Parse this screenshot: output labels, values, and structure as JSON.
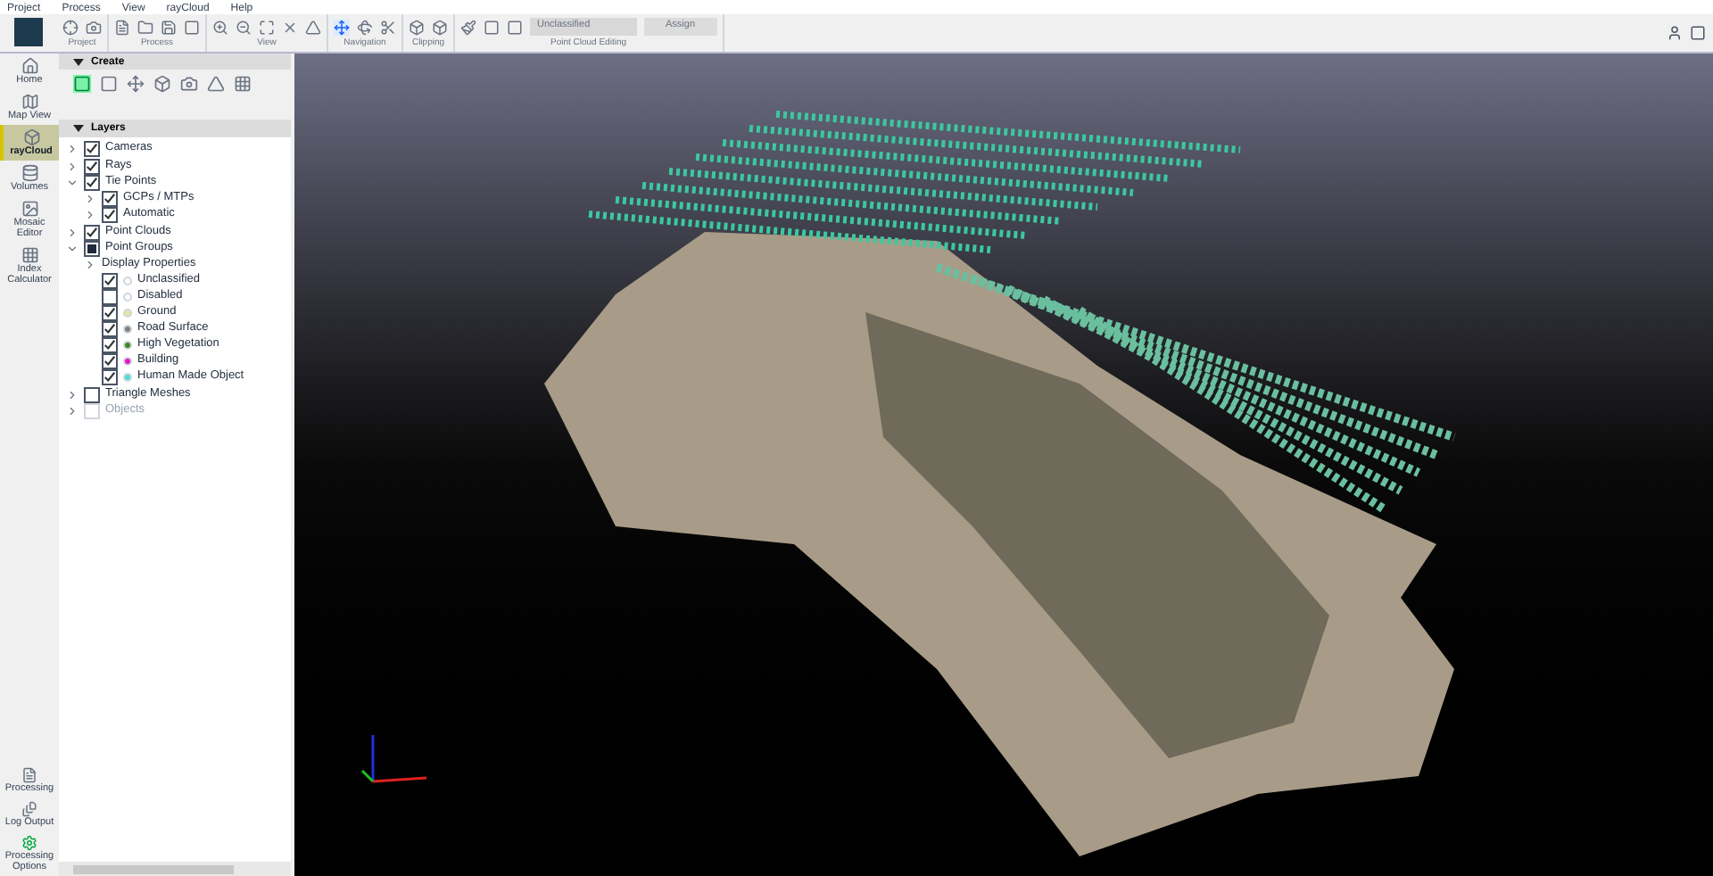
{
  "menu": [
    "Project",
    "Process",
    "View",
    "rayCloud",
    "Help"
  ],
  "toolbar_groups": [
    {
      "label": "Project"
    },
    {
      "label": "Process"
    },
    {
      "label": "View"
    },
    {
      "label": "Navigation"
    },
    {
      "label": "Clipping"
    },
    {
      "label": "Point Cloud Editing"
    }
  ],
  "class_field": {
    "value": "Unclassified"
  },
  "assign_button": "Assign",
  "rail": [
    {
      "label": "Home",
      "selected": false
    },
    {
      "label": "Map View",
      "selected": false
    },
    {
      "label": "rayCloud",
      "selected": true
    },
    {
      "label": "Volumes",
      "selected": false
    },
    {
      "label": "Mosaic Editor",
      "selected": false
    },
    {
      "label": "Index Calculator",
      "selected": false
    }
  ],
  "rail_bottom": [
    "Processing",
    "Log Output",
    "Processing Options"
  ],
  "create_panel": {
    "title": "Create"
  },
  "layers_panel": {
    "title": "Layers"
  },
  "layers": [
    {
      "label": "Cameras",
      "checked": true,
      "expanded": false
    },
    {
      "label": "Rays",
      "checked": true,
      "expanded": false
    },
    {
      "label": "Tie Points",
      "checked": true,
      "expanded": true,
      "children": [
        {
          "label": "GCPs / MTPs",
          "checked": true,
          "expanded": false
        },
        {
          "label": "Automatic",
          "checked": true,
          "expanded": false
        }
      ]
    },
    {
      "label": "Point Clouds",
      "checked": true,
      "expanded": false
    },
    {
      "label": "Point Groups",
      "mixed": true,
      "expanded": true,
      "children": [
        {
          "label": "Display Properties",
          "expanded": false
        },
        {
          "label": "Unclassified",
          "checked": true,
          "color": "#ffffff"
        },
        {
          "label": "Disabled",
          "checked": false,
          "color": "#ffffff"
        },
        {
          "label": "Ground",
          "checked": true,
          "color": "#e6e6a0"
        },
        {
          "label": "Road Surface",
          "checked": true,
          "color": "#808080"
        },
        {
          "label": "High Vegetation",
          "checked": true,
          "color": "#3c8c1e"
        },
        {
          "label": "Building",
          "checked": true,
          "color": "#e619c8"
        },
        {
          "label": "Human Made Object",
          "checked": true,
          "color": "#50dcdc"
        }
      ]
    },
    {
      "label": "Triangle Meshes",
      "checked": false,
      "expanded": false
    },
    {
      "label": "Objects",
      "checked": false,
      "expanded": false,
      "disabled": true
    }
  ]
}
